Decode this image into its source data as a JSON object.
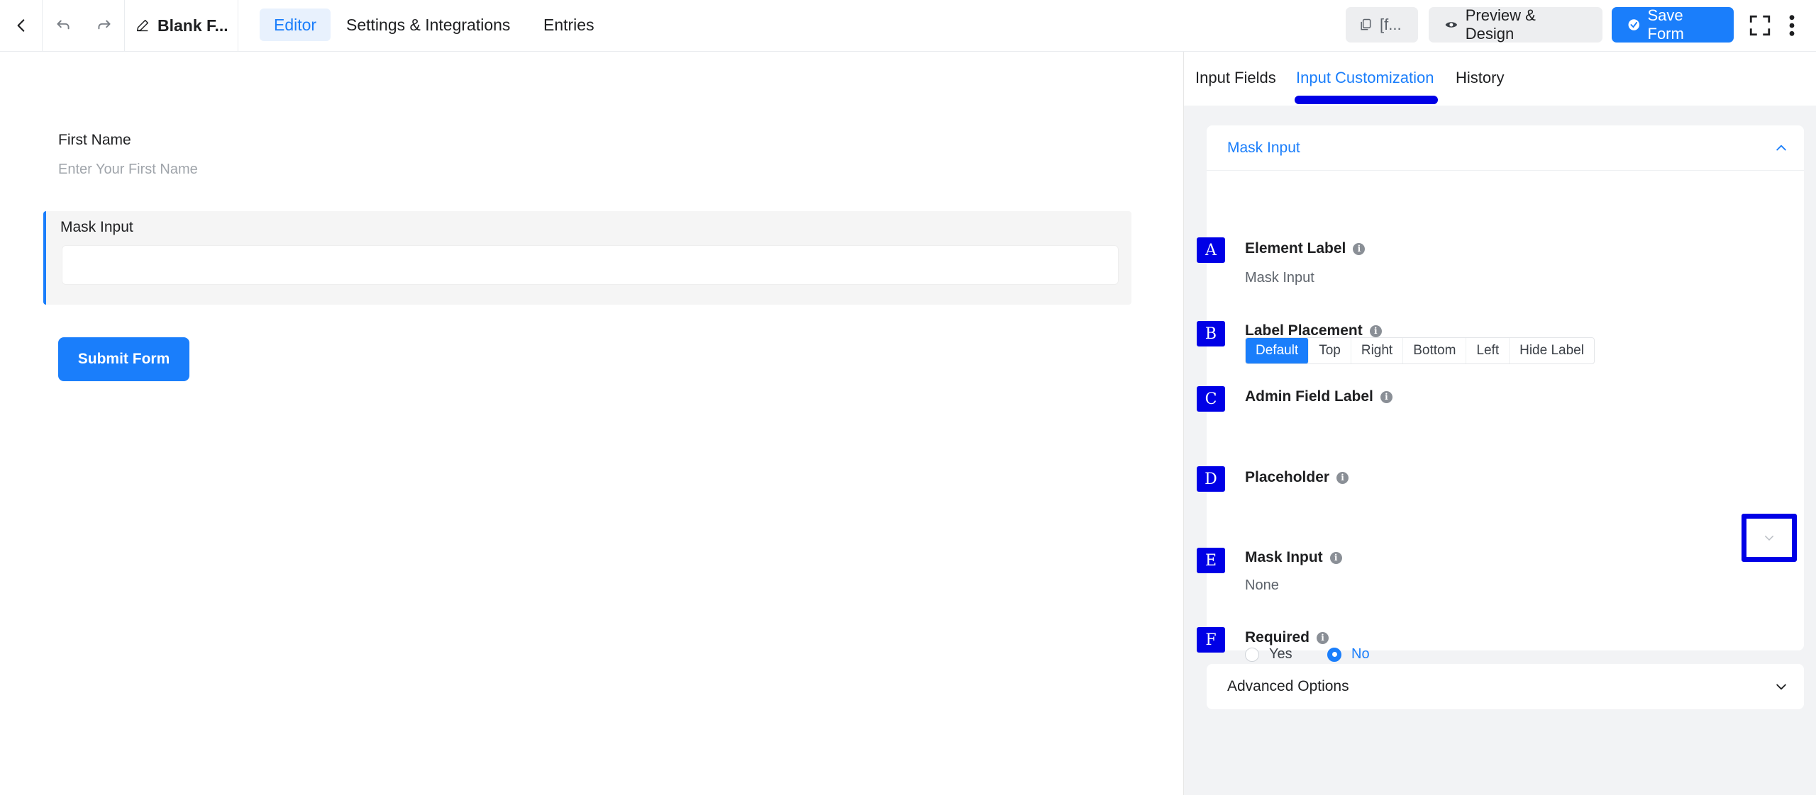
{
  "header": {
    "form_title": "Blank F...",
    "tabs": [
      {
        "label": "Editor",
        "active": true
      },
      {
        "label": "Settings & Integrations",
        "active": false
      },
      {
        "label": "Entries",
        "active": false
      }
    ],
    "shortcode_label": "[f...",
    "preview_label": "Preview & Design",
    "save_label": "Save Form"
  },
  "canvas": {
    "first_name_label": "First Name",
    "first_name_placeholder": "Enter Your First Name",
    "mask_input_label": "Mask Input",
    "submit_label": "Submit Form"
  },
  "panel": {
    "tabs": [
      {
        "label": "Input Fields",
        "active": false
      },
      {
        "label": "Input Customization",
        "active": true
      },
      {
        "label": "History",
        "active": false
      }
    ],
    "section_title": "Mask Input",
    "settings": {
      "element_label": {
        "marker": "A",
        "label": "Element Label",
        "value": "Mask Input"
      },
      "label_placement": {
        "marker": "B",
        "label": "Label Placement",
        "options": [
          "Default",
          "Top",
          "Right",
          "Bottom",
          "Left",
          "Hide Label"
        ],
        "selected": "Default"
      },
      "admin_field_label": {
        "marker": "C",
        "label": "Admin Field Label"
      },
      "placeholder": {
        "marker": "D",
        "label": "Placeholder"
      },
      "mask_input": {
        "marker": "E",
        "label": "Mask Input",
        "value": "None"
      },
      "required": {
        "marker": "F",
        "label": "Required",
        "yes": "Yes",
        "no": "No",
        "selected": "No"
      }
    },
    "advanced_title": "Advanced Options"
  },
  "colors": {
    "accent": "#1a7efb",
    "marker": "#0000e6"
  }
}
